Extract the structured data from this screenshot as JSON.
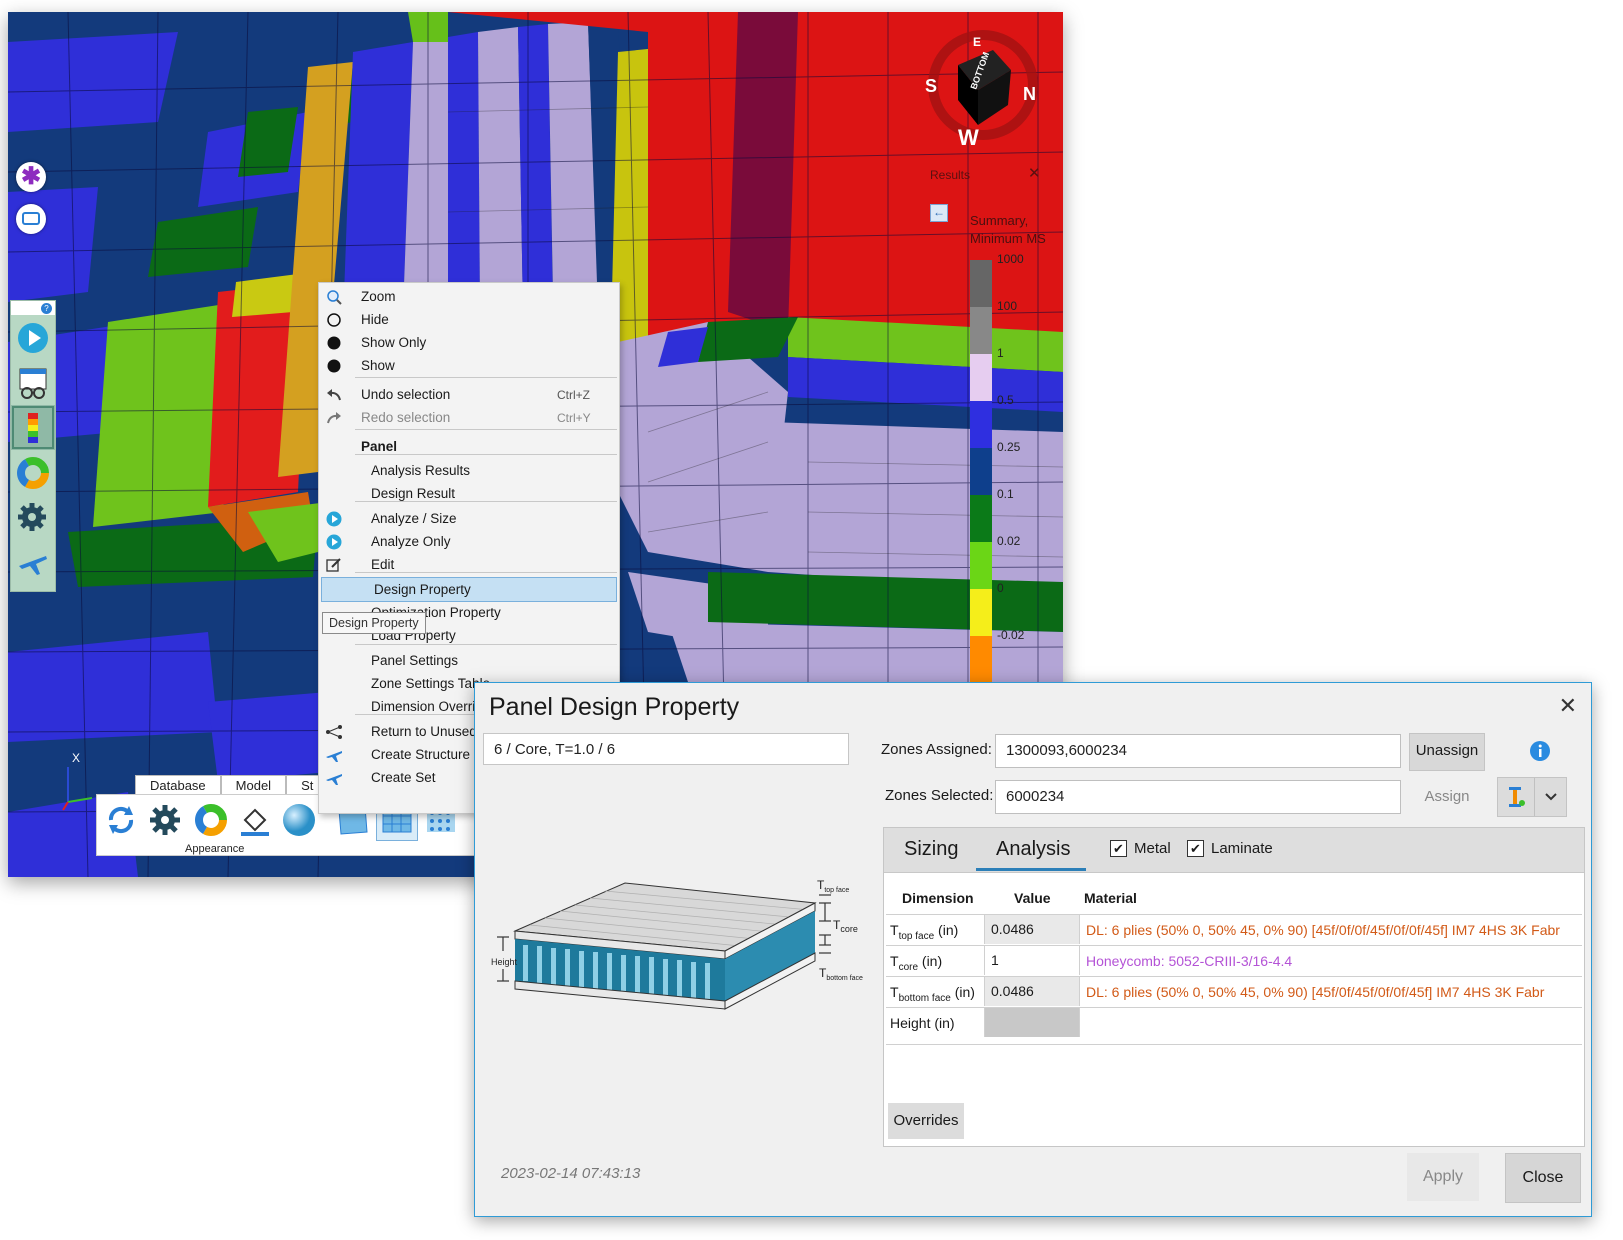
{
  "context_menu": {
    "items": [
      {
        "label": "Zoom",
        "icon": "zoom-icon"
      },
      {
        "label": "Hide",
        "icon": "hide-icon"
      },
      {
        "label": "Show Only",
        "icon": "show-only-icon"
      },
      {
        "label": "Show",
        "icon": "show-icon"
      },
      {
        "label": "Undo selection",
        "shortcut": "Ctrl+Z",
        "icon": "undo-icon"
      },
      {
        "label": "Redo selection",
        "shortcut": "Ctrl+Y",
        "icon": "redo-icon",
        "disabled": true
      },
      {
        "label": "Panel",
        "header": true
      },
      {
        "label": "Analysis Results"
      },
      {
        "label": "Design Result"
      },
      {
        "label": "Analyze / Size",
        "icon": "play-icon"
      },
      {
        "label": "Analyze Only",
        "icon": "play-icon"
      },
      {
        "label": "Edit",
        "icon": "edit-icon"
      },
      {
        "label": "Design Property",
        "highlighted": true
      },
      {
        "label": "Optimization Property"
      },
      {
        "label": "Load Property"
      },
      {
        "label": "Panel Settings"
      },
      {
        "label": "Zone Settings Table"
      },
      {
        "label": "Dimension Overrides"
      },
      {
        "label": "Return to Unused",
        "icon": "tree-icon"
      },
      {
        "label": "Create Structure",
        "icon": "airplane-icon"
      },
      {
        "label": "Create Set",
        "icon": "airplane-icon"
      }
    ],
    "tooltip": "Design Property"
  },
  "results_panel": {
    "title": "Results",
    "summary": "Summary, Minimum MS",
    "legend": [
      {
        "label": "1000",
        "color": "#666666"
      },
      {
        "label": "100",
        "color": "#888888"
      },
      {
        "label": "1",
        "color": "#e6cdf0"
      },
      {
        "label": "0.5",
        "color": "#2f2fe0"
      },
      {
        "label": "0.25",
        "color": "#0e3f8c"
      },
      {
        "label": "0.1",
        "color": "#0b7a18"
      },
      {
        "label": "0.02",
        "color": "#6bd616"
      },
      {
        "label": "0",
        "color": "#f5ee1a"
      },
      {
        "label": "-0.02",
        "color": "#ff8a00"
      },
      {
        "label": "",
        "color": "#e01010"
      }
    ]
  },
  "navcube": {
    "face": "BOTTOM",
    "letters": [
      "S",
      "E",
      "N",
      "W"
    ]
  },
  "ribbon": {
    "tabs": [
      "Database",
      "Model",
      "St"
    ],
    "group_label": "Appearance"
  },
  "axis_label": "X",
  "dialog": {
    "title": "Panel Design Property",
    "close_glyph": "✕",
    "property_name": "6 / Core, T=1.0 / 6",
    "zones_assigned_label": "Zones Assigned:",
    "zones_assigned_value": "1300093,6000234",
    "zones_selected_label": "Zones Selected:",
    "zones_selected_value": "6000234",
    "unassign_label": "Unassign",
    "assign_label": "Assign",
    "tabs": {
      "sizing": "Sizing",
      "analysis": "Analysis"
    },
    "checkboxes": {
      "metal": "Metal",
      "laminate": "Laminate"
    },
    "grid": {
      "headers": {
        "dimension": "Dimension",
        "value": "Value",
        "material": "Material"
      },
      "rows": [
        {
          "dim_main": "T",
          "dim_sub": "top face",
          "dim_unit": " (in)",
          "value": "0.0486",
          "material": "DL: 6 plies (50% 0, 50% 45, 0% 90) [45f/0f/0f/45f/0f/0f/45f] IM7 4HS 3K Fabr",
          "material_color": "#d25a17"
        },
        {
          "dim_main": "T",
          "dim_sub": "core",
          "dim_unit": " (in)",
          "value": "1",
          "material": "Honeycomb: 5052-CRIII-3/16-4.4",
          "material_color": "#b453d6"
        },
        {
          "dim_main": "T",
          "dim_sub": "bottom face",
          "dim_unit": " (in)",
          "value": "0.0486",
          "material": "DL: 6 plies (50% 0, 50% 45, 0% 90) [45f/0f/45f/0f/0f/45f] IM7 4HS 3K Fabr",
          "material_color": "#d25a17"
        },
        {
          "dim_main": "Height",
          "dim_sub": "",
          "dim_unit": " (in)",
          "value": "",
          "material": "",
          "material_color": "#000000"
        }
      ]
    },
    "overrides_label": "Overrides",
    "timestamp": "2023-02-14 07:43:13",
    "apply_label": "Apply",
    "close_label": "Close",
    "diagram_labels": {
      "t_top": "T",
      "t_top_sub": "top face",
      "t_core": "T",
      "t_core_sub": "core",
      "t_bottom": "T",
      "t_bottom_sub": "bottom face",
      "height": "Height"
    }
  }
}
